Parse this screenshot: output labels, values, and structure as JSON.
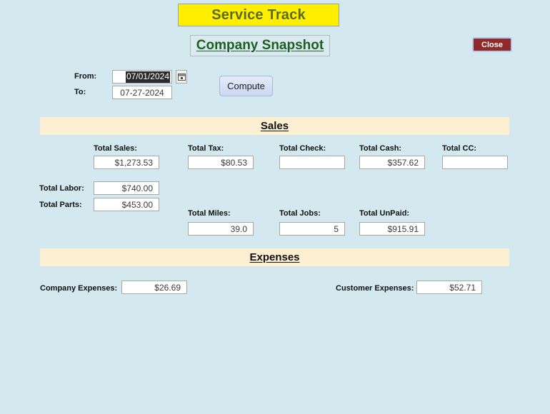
{
  "app": {
    "title": "Service Track",
    "subtitle": "Company Snapshot",
    "title_bg": "#ffee00",
    "title_color": "#5c6b16",
    "subtitle_color": "#1f5e23",
    "page_bg": "#d3e9ef",
    "section_bar_bg": "#fcefd2"
  },
  "toolbar": {
    "close_label": "Close",
    "close_bg": "#8e2a2a",
    "compute_label": "Compute"
  },
  "date_range": {
    "from_label": "From:",
    "from_value": "07/01/2024",
    "from_selected": true,
    "to_label": "To:",
    "to_value": "07-27-2024",
    "date_picker_icon": "calendar-icon"
  },
  "sections": {
    "sales": {
      "heading": "Sales",
      "fields": [
        {
          "label": "Total Sales:",
          "value": "$1,273.53"
        },
        {
          "label": "Total Tax:",
          "value": "$80.53"
        },
        {
          "label": "Total Check:",
          "value": ""
        },
        {
          "label": "Total Cash:",
          "value": "$357.62"
        },
        {
          "label": "Total CC:",
          "value": ""
        },
        {
          "label": "Total Labor:",
          "value": "$740.00"
        },
        {
          "label": "Total Parts:",
          "value": "$453.00"
        },
        {
          "label": "Total Miles:",
          "value": "39.0"
        },
        {
          "label": "Total Jobs:",
          "value": "5"
        },
        {
          "label": "Total UnPaid:",
          "value": "$915.91"
        }
      ]
    },
    "expenses": {
      "heading": "Expenses",
      "fields": [
        {
          "label": "Company Expenses:",
          "value": "$26.69"
        },
        {
          "label": "Customer Expenses:",
          "value": "$52.71"
        }
      ]
    }
  }
}
